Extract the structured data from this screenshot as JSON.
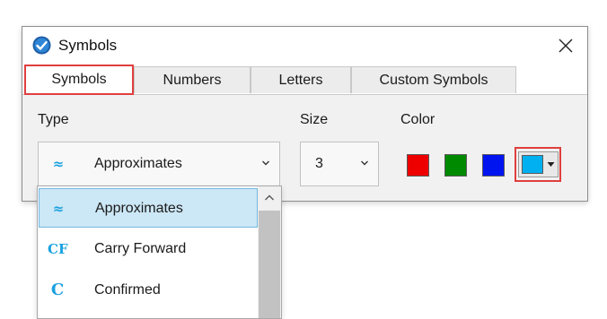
{
  "window": {
    "title": "Symbols"
  },
  "tabs": [
    {
      "label": "Symbols"
    },
    {
      "label": "Numbers"
    },
    {
      "label": "Letters"
    },
    {
      "label": "Custom Symbols"
    }
  ],
  "type_field": {
    "label": "Type",
    "selected_symbol": "≈",
    "selected_value": "Approximates"
  },
  "size_field": {
    "label": "Size",
    "selected_value": "3"
  },
  "color_field": {
    "label": "Color",
    "swatches": [
      "#ee0000",
      "#008a00",
      "#0014f0"
    ],
    "current": "#00b0f0"
  },
  "dropdown": {
    "options": [
      {
        "symbol": "≈",
        "label": "Approximates"
      },
      {
        "symbol": "CF",
        "label": "Carry Forward"
      },
      {
        "symbol": "C",
        "label": "Confirmed"
      }
    ]
  }
}
